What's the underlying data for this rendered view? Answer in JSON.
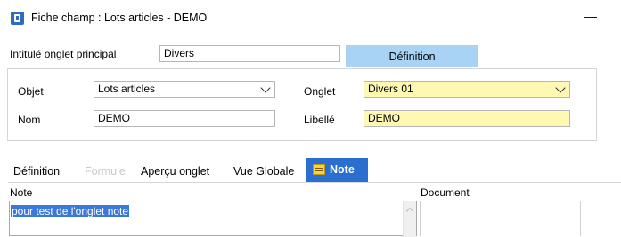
{
  "window": {
    "title": "Fiche champ : Lots articles - DEMO",
    "minimize_glyph": "—"
  },
  "header": {
    "main_tab_label": "Intitulé onglet principal",
    "main_tab_value": "Divers",
    "definition_button": "Définition"
  },
  "form": {
    "objet_label": "Objet",
    "objet_value": "Lots articles",
    "nom_label": "Nom",
    "nom_value": "DEMO",
    "onglet_label": "Onglet",
    "onglet_value": "Divers 01",
    "libelle_label": "Libellé",
    "libelle_value": "DEMO"
  },
  "tabs": [
    {
      "label": "Définition",
      "state": "normal"
    },
    {
      "label": "Formule",
      "state": "disabled"
    },
    {
      "label": "Aperçu onglet",
      "state": "normal"
    },
    {
      "label": "Vue Globale",
      "state": "normal"
    },
    {
      "label": "Note",
      "state": "active",
      "icon": "note-icon"
    }
  ],
  "note_panel": {
    "note_label": "Note",
    "note_text": "pour test de l'onglet note",
    "document_label": "Document"
  },
  "colors": {
    "accent": "#2a6fd0",
    "button": "#a9d3f5",
    "highlight_field": "#fff8b3",
    "selection": "#3b78d7"
  }
}
